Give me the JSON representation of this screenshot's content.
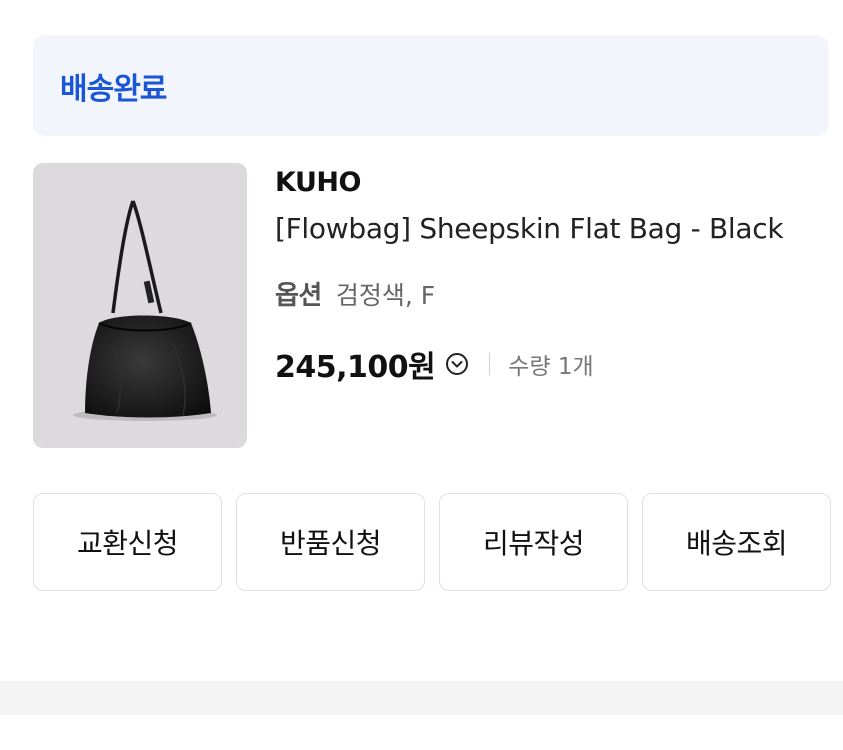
{
  "order_status": {
    "label": "배송완료"
  },
  "product": {
    "brand": "KUHO",
    "name": "[Flowbag] Sheepskin Flat Bag - Black",
    "option_label": "옵션",
    "option_value": "검정색, F",
    "price": "245,100원",
    "quantity": "수량 1개",
    "image_icon": "black-leather-shoulder-bag"
  },
  "actions": {
    "exchange": "교환신청",
    "return": "반품신청",
    "review": "리뷰작성",
    "tracking": "배송조회"
  },
  "colors": {
    "accent": "#1b56d6",
    "status_bg": "#f2f5fc"
  }
}
